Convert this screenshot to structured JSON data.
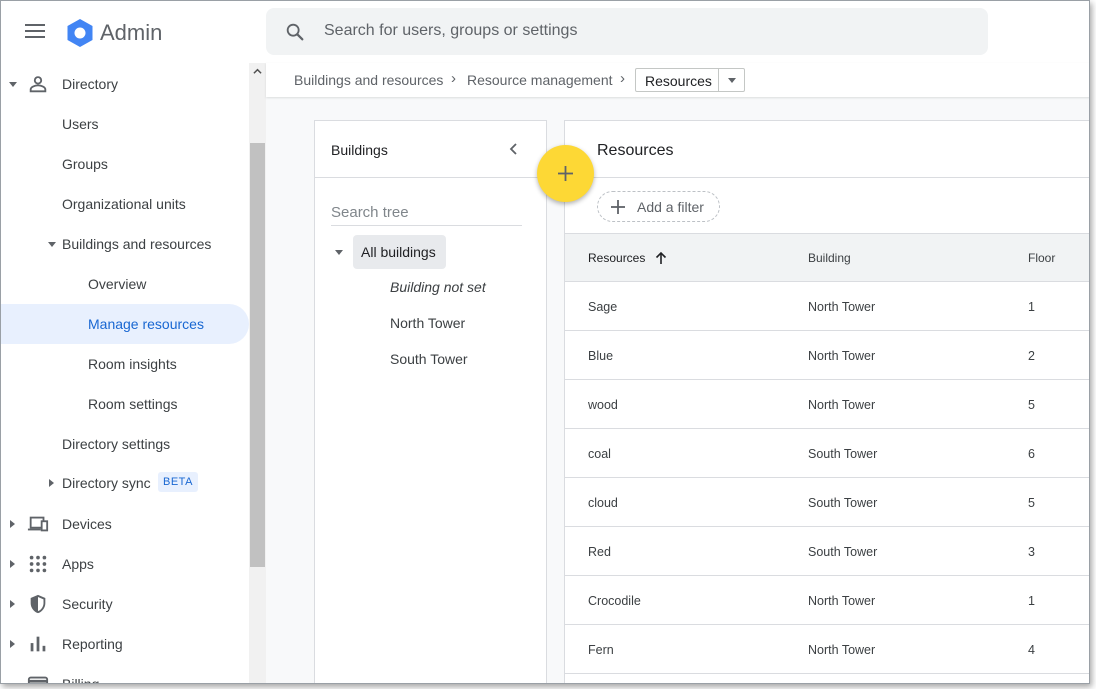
{
  "header": {
    "app_title": "Admin",
    "search_placeholder": "Search for users, groups or settings"
  },
  "sidebar": {
    "directory": "Directory",
    "users": "Users",
    "groups": "Groups",
    "org_units": "Organizational units",
    "buildings_resources": "Buildings and resources",
    "overview": "Overview",
    "manage_resources": "Manage resources",
    "room_insights": "Room insights",
    "room_settings": "Room settings",
    "directory_settings": "Directory settings",
    "directory_sync": "Directory sync",
    "beta_badge": "BETA",
    "devices": "Devices",
    "apps": "Apps",
    "security": "Security",
    "reporting": "Reporting",
    "billing": "Billing"
  },
  "breadcrumb": {
    "item1": "Buildings and resources",
    "item2": "Resource management",
    "current": "Resources"
  },
  "buildings_panel": {
    "title": "Buildings",
    "search_placeholder": "Search tree",
    "root": "All buildings",
    "items": [
      "Building not set",
      "North Tower",
      "South Tower"
    ]
  },
  "resources_panel": {
    "title": "Resources",
    "add_filter": "Add a filter",
    "columns": [
      "Resources",
      "Building",
      "Floor"
    ],
    "rows": [
      {
        "name": "Sage",
        "building": "North Tower",
        "floor": "1"
      },
      {
        "name": "Blue",
        "building": "North Tower",
        "floor": "2"
      },
      {
        "name": "wood",
        "building": "North Tower",
        "floor": "5"
      },
      {
        "name": "coal",
        "building": "South Tower",
        "floor": "6"
      },
      {
        "name": "cloud",
        "building": "South Tower",
        "floor": "5"
      },
      {
        "name": "Red",
        "building": "South Tower",
        "floor": "3"
      },
      {
        "name": "Crocodile",
        "building": "North Tower",
        "floor": "1"
      },
      {
        "name": "Fern",
        "building": "North Tower",
        "floor": "4"
      }
    ]
  },
  "colors": {
    "accent": "#1967d2",
    "active_bg": "#e8f0fe",
    "fab": "#fdd835",
    "logo": "#4285f4"
  }
}
